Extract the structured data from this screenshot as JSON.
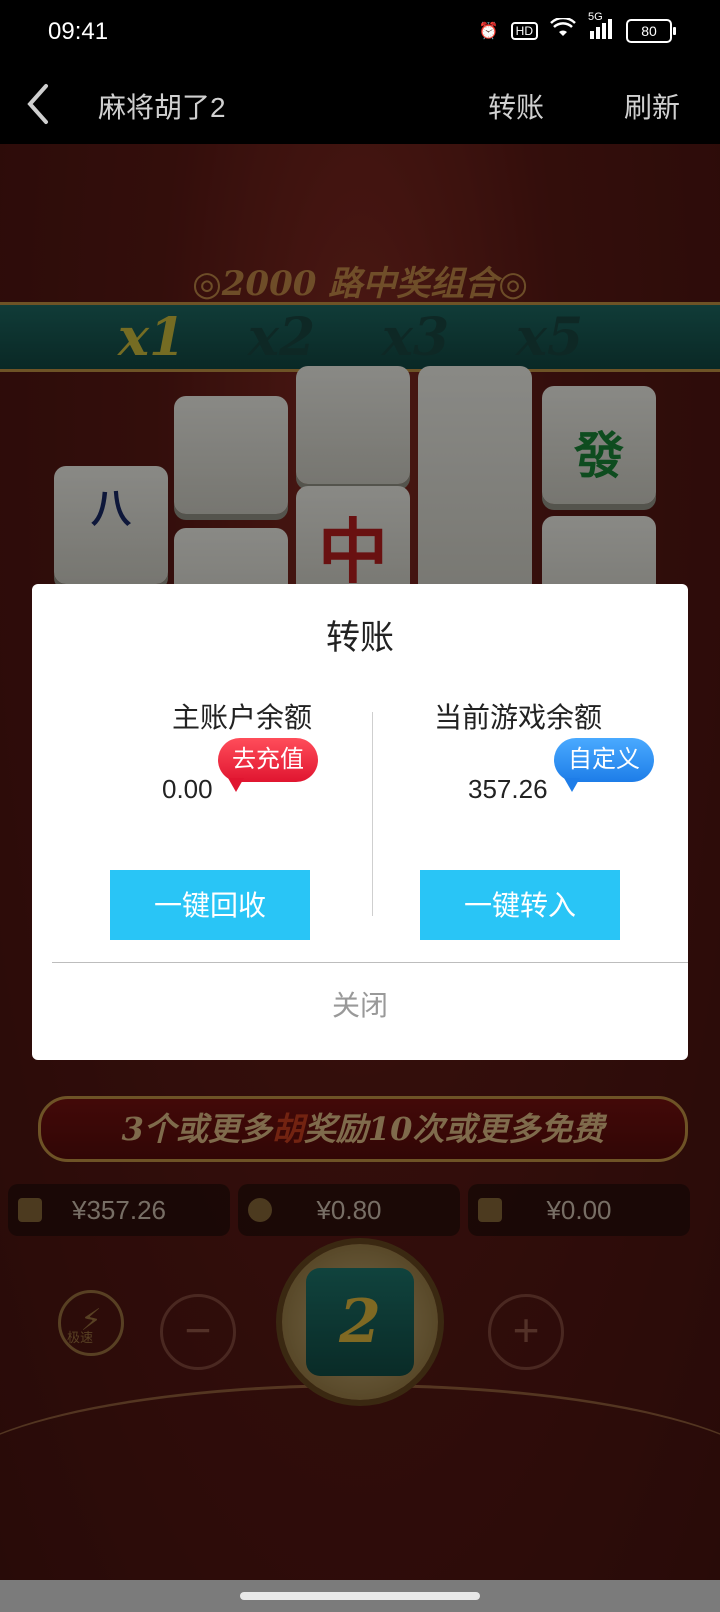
{
  "status_bar": {
    "time": "09:41",
    "network": "5G",
    "battery": "80",
    "hd": "HD"
  },
  "nav": {
    "title": "麻将胡了2",
    "transfer": "转账",
    "refresh": "刷新"
  },
  "game": {
    "combo_title": "◎2000 路中奖组合◎",
    "multipliers": [
      "x1",
      "x2",
      "x3",
      "x5"
    ],
    "active_multiplier": "x1",
    "banner_parts": [
      "3个或更多",
      "胡",
      "奖励10次或更多免费"
    ],
    "balance": "¥357.26",
    "bet": "¥0.80",
    "win": "¥0.00",
    "spin_label": "2",
    "turbo_label": "极速",
    "minus": "−",
    "plus": "+"
  },
  "modal": {
    "title": "转账",
    "main_label": "主账户余额",
    "main_amount": "0.00",
    "recharge_bubble": "去充值",
    "game_label": "当前游戏余额",
    "game_amount": "357.26",
    "custom_bubble": "自定义",
    "recycle_button": "一键回收",
    "transfer_in_button": "一键转入",
    "close": "关闭"
  }
}
